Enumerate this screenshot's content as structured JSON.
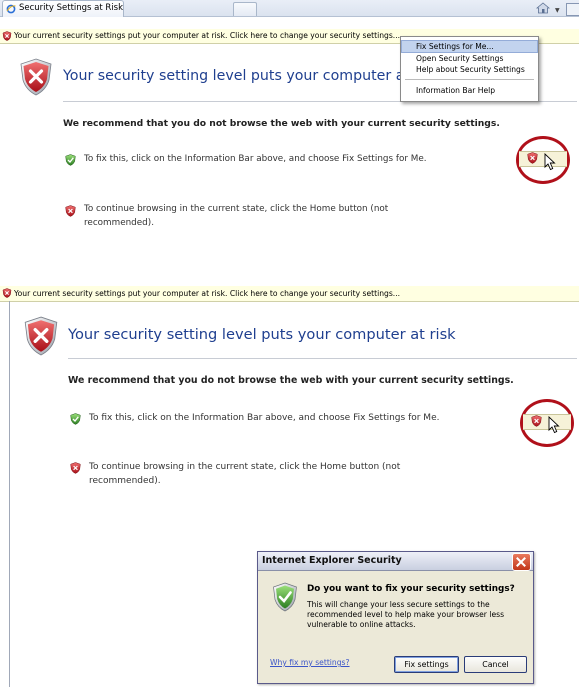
{
  "panel1": {
    "tab_title": "Security Settings at Risk",
    "infobar_text": "Your current security settings put your computer at risk. Click here to change your security settings...",
    "heading": "Your security setting level puts your computer at risk",
    "recommend": "We recommend that you do not browse the web with your current security settings.",
    "tip1": "To fix this, click on the Information Bar above, and choose Fix Settings for Me.",
    "tip2_line1": "To continue browsing in the current state, click the Home button (not",
    "tip2_line2": "recommended).",
    "menu": {
      "item1": "Fix Settings for Me...",
      "item2": "Open Security Settings",
      "item3": "Help about Security Settings",
      "item4": "Information Bar Help"
    }
  },
  "panel2": {
    "infobar_text": "Your current security settings put your computer at risk. Click here to change your security settings...",
    "heading": "Your security setting level puts your computer at risk",
    "recommend": "We recommend that you do not browse the web with your current security settings.",
    "tip1": "To fix this, click on the Information Bar above, and choose Fix Settings for Me.",
    "tip2_line1": "To continue browsing in the current state, click the Home button (not",
    "tip2_line2": "recommended)."
  },
  "dialog": {
    "title": "Internet Explorer Security",
    "question": "Do you want to fix your security settings?",
    "body": "This will change your less secure settings to the recommended level to help make your browser less vulnerable to online attacks.",
    "link": "Why fix my settings?",
    "fix_button": "Fix settings",
    "cancel_button": "Cancel"
  },
  "colors": {
    "heading": "#1f3f8f",
    "infobar": "#ffffe1",
    "shield_red": "#c0202a",
    "shield_green": "#3b9a2e",
    "highlight_ring": "#b0101a"
  }
}
